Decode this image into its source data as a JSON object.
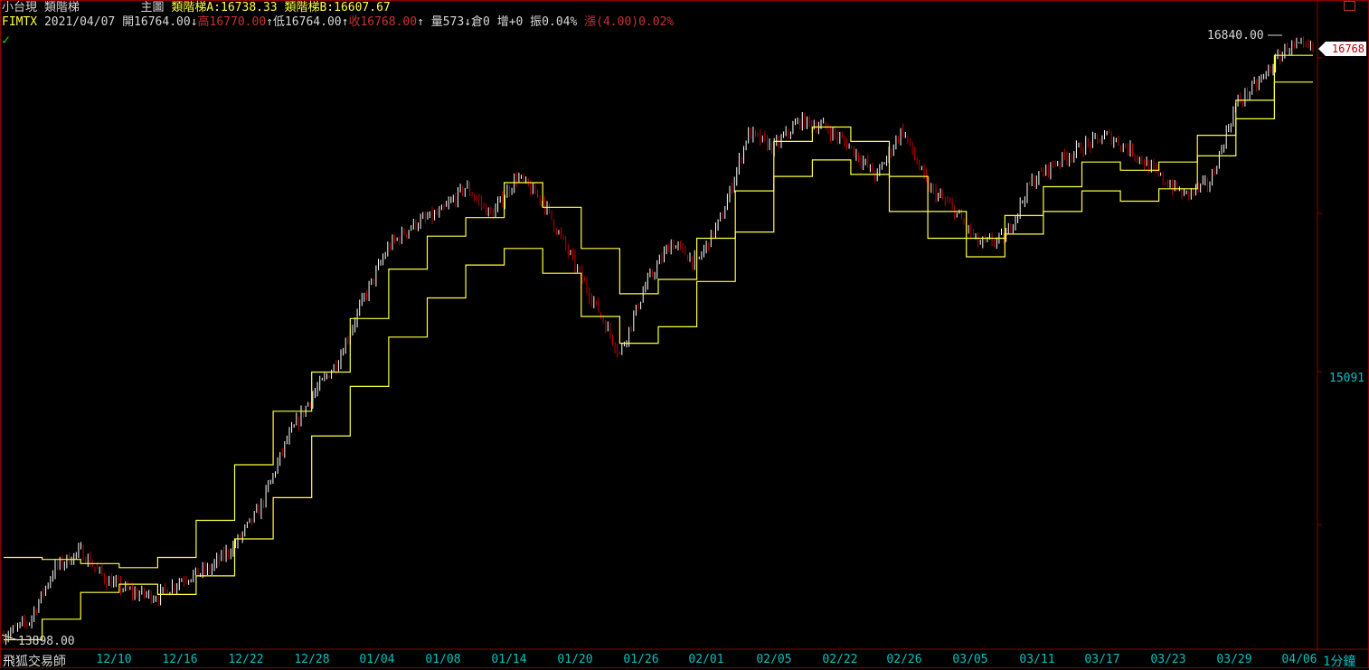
{
  "header": {
    "symbol_name": "小台現",
    "indicator_name": "類階梯",
    "panel": "主圖",
    "ind_a": "類階梯A:16738.33",
    "ind_b": "類階梯B:16607.67"
  },
  "quote": {
    "code": "FIMTX",
    "date": "2021/04/07",
    "open": "開16764.00",
    "open_arrow": "↓",
    "high": "高16770.00",
    "high_arrow": "↑",
    "low": "低16764.00",
    "low_arrow": "↑",
    "close": "收16768.00",
    "close_arrow": "↑",
    "volume": "量573",
    "volume_arrow": "↓",
    "oi": "倉0",
    "oi_change": "增+0",
    "amplitude": "振0.04%",
    "change": "漲(4.00)0.02%"
  },
  "checkmark": "✓",
  "brand": "飛狐交易師",
  "period": "1分鐘",
  "price_tag": "16768",
  "price_mid": "15091",
  "high_label": "16840.00",
  "low_label": "13898.00",
  "colors": {
    "background": "#000000",
    "step_line": "#ffff40",
    "up_bar": "#ffffff",
    "down_bar": "#c00000",
    "axis": "#8b0000",
    "label": "#00c0c0"
  },
  "chart_data": {
    "type": "line",
    "x_labels": [
      "12/10",
      "12/16",
      "12/22",
      "12/28",
      "01/04",
      "01/08",
      "01/14",
      "01/20",
      "01/26",
      "02/01",
      "02/05",
      "02/22",
      "02/26",
      "03/05",
      "03/11",
      "03/17",
      "03/23",
      "03/29",
      "04/06"
    ],
    "ylim": [
      13898,
      16840
    ],
    "price_series": [
      13920,
      13990,
      14250,
      14330,
      14190,
      14130,
      14110,
      14200,
      14240,
      14360,
      14540,
      14860,
      15080,
      15250,
      15550,
      15810,
      15920,
      15970,
      16100,
      15960,
      16150,
      16030,
      15780,
      15540,
      15290,
      15620,
      15830,
      15730,
      15960,
      16360,
      16290,
      16420,
      16390,
      16290,
      16150,
      16380,
      16100,
      15990,
      15820,
      15850,
      16120,
      16220,
      16290,
      16350,
      16270,
      16150,
      16060,
      16120,
      16500,
      16620,
      16780,
      16770
    ],
    "step_a": [
      14300,
      14290,
      14270,
      14250,
      14300,
      14480,
      14750,
      15010,
      15200,
      15460,
      15700,
      15860,
      15950,
      16120,
      16000,
      15800,
      15580,
      15650,
      15850,
      16080,
      16320,
      16390,
      16320,
      16150,
      15980,
      15850,
      15960,
      16100,
      16220,
      16180,
      16220,
      16350,
      16520,
      16738
    ],
    "step_b": [
      13900,
      14000,
      14130,
      14170,
      14120,
      14210,
      14390,
      14590,
      14890,
      15130,
      15370,
      15560,
      15720,
      15800,
      15680,
      15470,
      15340,
      15420,
      15640,
      15880,
      16150,
      16230,
      16160,
      15980,
      15850,
      15760,
      15870,
      15980,
      16080,
      16030,
      16090,
      16250,
      16430,
      16608
    ]
  }
}
